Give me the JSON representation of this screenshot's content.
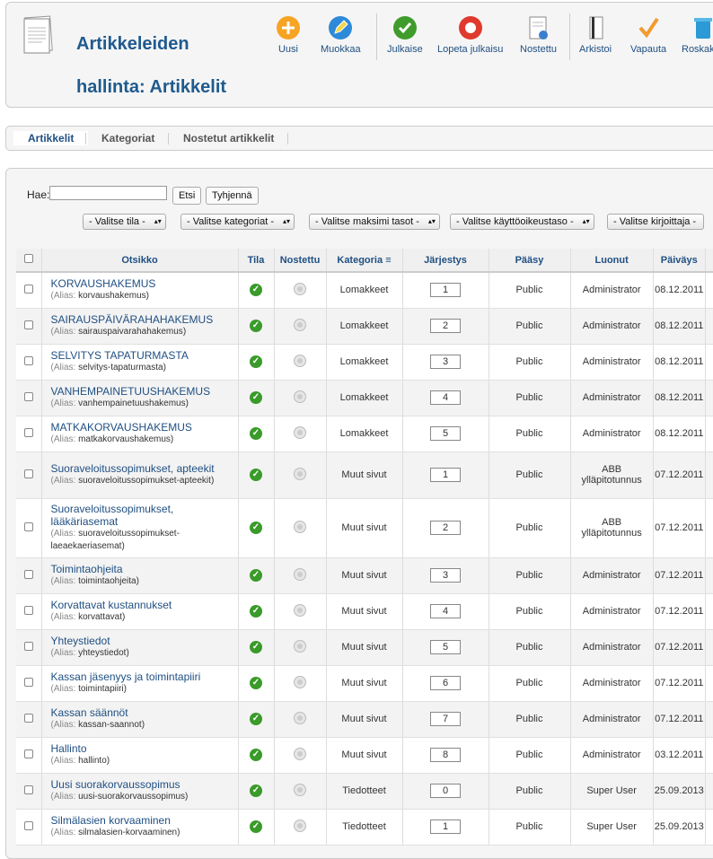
{
  "header": {
    "title": "Artikkeleiden hallinta: Artikkelit"
  },
  "toolbar": {
    "new": "Uusi",
    "edit": "Muokkaa",
    "publish": "Julkaise",
    "unpublish": "Lopeta julkaisu",
    "featured": "Nostettu",
    "archive": "Arkistoi",
    "checkin": "Vapauta",
    "trash": "Roskakori"
  },
  "tabs": [
    "Artikkelit",
    "Kategoriat",
    "Nostetut artikkelit"
  ],
  "filters": {
    "search_label": "Hae:",
    "search_value": "",
    "search_button": "Etsi",
    "clear_button": "Tyhjennä",
    "state": "- Valitse tila -",
    "category": "- Valitse kategoriat -",
    "max_levels": "- Valitse maksimi tasot -",
    "access": "- Valitse käyttöoikeustaso -",
    "author": "- Valitse kirjoittaja -"
  },
  "columns": {
    "title": "Otsikko",
    "state": "Tila",
    "featured": "Nostettu",
    "category": "Kategoria",
    "ordering": "Järjestys",
    "access": "Pääsy",
    "created_by": "Luonut",
    "date": "Päiväys"
  },
  "alias_label": "(Alias:",
  "rows": [
    {
      "title": "KORVAUSHAKEMUS",
      "alias": "korvaushakemus",
      "category": "Lomakkeet",
      "order": "1",
      "access": "Public",
      "author": "Administrator",
      "date": "08.12.2011"
    },
    {
      "title": "SAIRAUSPÄIVÄRAHAHAKEMUS",
      "alias": "sairauspaivarahahakemus",
      "category": "Lomakkeet",
      "order": "2",
      "access": "Public",
      "author": "Administrator",
      "date": "08.12.2011"
    },
    {
      "title": "SELVITYS TAPATURMASTA",
      "alias": "selvitys-tapaturmasta",
      "category": "Lomakkeet",
      "order": "3",
      "access": "Public",
      "author": "Administrator",
      "date": "08.12.2011"
    },
    {
      "title": "VANHEMPAINETUUSHAKEMUS",
      "alias": "vanhempainetuushakemus",
      "category": "Lomakkeet",
      "order": "4",
      "access": "Public",
      "author": "Administrator",
      "date": "08.12.2011"
    },
    {
      "title": "MATKAKORVAUSHAKEMUS",
      "alias": "matkakorvaushakemus",
      "category": "Lomakkeet",
      "order": "5",
      "access": "Public",
      "author": "Administrator",
      "date": "08.12.2011"
    },
    {
      "title": "Suoraveloitussopimukset, apteekit",
      "alias": "suoraveloitussopimukset-apteekit",
      "category": "Muut sivut",
      "order": "1",
      "access": "Public",
      "author": "ABB ylläpitotunnus",
      "date": "07.12.2011"
    },
    {
      "title": "Suoraveloitussopimukset, lääkäriasemat",
      "alias": "suoraveloitussopimukset-laeaekaeriasemat",
      "category": "Muut sivut",
      "order": "2",
      "access": "Public",
      "author": "ABB ylläpitotunnus",
      "date": "07.12.2011"
    },
    {
      "title": "Toimintaohjeita",
      "alias": "toimintaohjeita",
      "category": "Muut sivut",
      "order": "3",
      "access": "Public",
      "author": "Administrator",
      "date": "07.12.2011"
    },
    {
      "title": "Korvattavat kustannukset",
      "alias": "korvattavat",
      "category": "Muut sivut",
      "order": "4",
      "access": "Public",
      "author": "Administrator",
      "date": "07.12.2011"
    },
    {
      "title": "Yhteystiedot",
      "alias": "yhteystiedot",
      "category": "Muut sivut",
      "order": "5",
      "access": "Public",
      "author": "Administrator",
      "date": "07.12.2011"
    },
    {
      "title": "Kassan jäsenyys ja toimintapiiri",
      "alias": "toimintapiiri",
      "category": "Muut sivut",
      "order": "6",
      "access": "Public",
      "author": "Administrator",
      "date": "07.12.2011"
    },
    {
      "title": "Kassan säännöt",
      "alias": "kassan-saannot",
      "category": "Muut sivut",
      "order": "7",
      "access": "Public",
      "author": "Administrator",
      "date": "07.12.2011"
    },
    {
      "title": "Hallinto",
      "alias": "hallinto",
      "category": "Muut sivut",
      "order": "8",
      "access": "Public",
      "author": "Administrator",
      "date": "03.12.2011"
    },
    {
      "title": "Uusi suorakorvaussopimus",
      "alias": "uusi-suorakorvaussopimus",
      "category": "Tiedotteet",
      "order": "0",
      "access": "Public",
      "author": "Super User",
      "date": "25.09.2013"
    },
    {
      "title": "Silmälasien korvaaminen",
      "alias": "silmalasien-korvaaminen",
      "category": "Tiedotteet",
      "order": "1",
      "access": "Public",
      "author": "Super User",
      "date": "25.09.2013"
    }
  ]
}
